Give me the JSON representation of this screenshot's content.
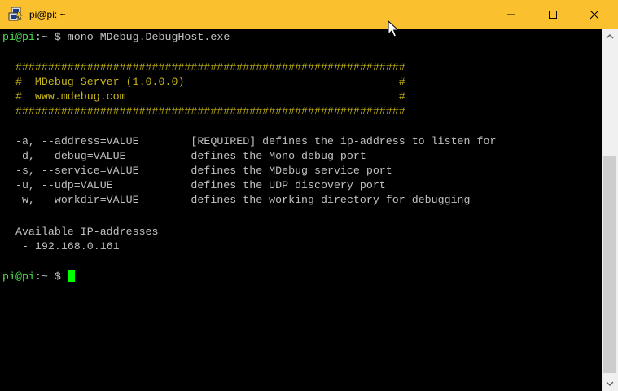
{
  "window": {
    "title": "pi@pi: ~"
  },
  "terminal": {
    "command_prompt": {
      "user_host": "pi@pi",
      "path_sep": ":~ $",
      "command": " mono MDebug.DebugHost.exe"
    },
    "banner": [
      "  ############################################################",
      "  #  MDebug Server (1.0.0.0)                                 #",
      "  #  www.mdebug.com                                          #",
      "  ############################################################"
    ],
    "options": [
      "  -a, --address=VALUE        [REQUIRED] defines the ip-address to listen for",
      "  -d, --debug=VALUE          defines the Mono debug port",
      "  -s, --service=VALUE        defines the MDebug service port",
      "  -u, --udp=VALUE            defines the UDP discovery port",
      "  -w, --workdir=VALUE        defines the working directory for debugging"
    ],
    "ip_header": "  Available IP-addresses",
    "ip_addresses": [
      "   - 192.168.0.161"
    ],
    "final_prompt": {
      "user_host": "pi@pi",
      "path_sep": ":~ $ "
    }
  },
  "icons": {
    "app": "putty-icon",
    "minimize": "minimize-icon",
    "maximize": "maximize-icon",
    "close": "close-icon"
  },
  "colors": {
    "titlebar": "#fbc02d",
    "prompt_green": "#4ae14a",
    "banner_yellow": "#c6b617",
    "text_gray": "#c0c0c0",
    "cursor": "#00ff00"
  }
}
